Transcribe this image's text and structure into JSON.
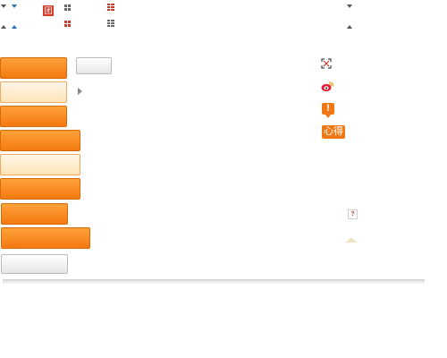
{
  "icons": {
    "calendar": "团",
    "alert": "!",
    "help": "?"
  },
  "badges": {
    "xinde": "心得"
  },
  "colors": {
    "orange": "#f37a10",
    "light_orange": "#ffe3b8",
    "blue_arrow": "#2b6fb6",
    "red": "#c0392b"
  }
}
